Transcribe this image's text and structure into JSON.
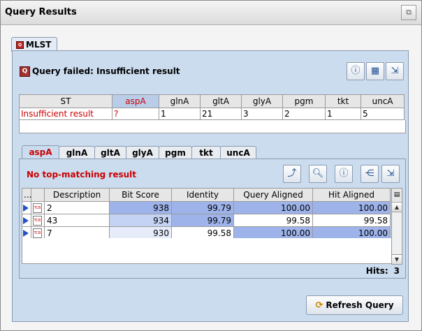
{
  "window": {
    "title": "Query Results",
    "restore_glyph": "⧉"
  },
  "outer_tab": {
    "label": "MLST",
    "icon": "q-icon"
  },
  "status": {
    "icon_glyph": "Q",
    "message": "Query failed: Insufficient result"
  },
  "toolbar_top": [
    {
      "name": "info-icon",
      "glyph": "ⓘ"
    },
    {
      "name": "table-icon",
      "glyph": "▦"
    },
    {
      "name": "export-icon",
      "glyph": "⇲"
    }
  ],
  "st_table": {
    "headers": [
      "ST",
      "aspA",
      "glnA",
      "gltA",
      "glyA",
      "pgm",
      "tkt",
      "uncA"
    ],
    "row": [
      "Insufficient result",
      "?",
      "1",
      "21",
      "3",
      "2",
      "1",
      "5"
    ]
  },
  "inner_tabs": [
    "aspA",
    "glnA",
    "gltA",
    "glyA",
    "pgm",
    "tkt",
    "uncA"
  ],
  "inner_panel": {
    "message": "No top-matching result",
    "toolbar": [
      {
        "name": "chart-icon",
        "glyph": "⤴"
      },
      {
        "name": "magnifier-icon",
        "glyph": "🔍︎"
      },
      {
        "name": "info-icon",
        "glyph": "ⓘ"
      },
      {
        "name": "tree-icon",
        "glyph": "⋲"
      },
      {
        "name": "export-icon",
        "glyph": "⇲"
      }
    ]
  },
  "results_table": {
    "headers": [
      "...",
      "Description",
      "Bit Score",
      "Identity",
      "Query Aligned",
      "Hit Aligned"
    ],
    "rows": [
      {
        "description": "2",
        "bit_score": "938",
        "identity": "99.79",
        "query_aligned": "100.00",
        "hit_aligned": "100.00"
      },
      {
        "description": "43",
        "bit_score": "934",
        "identity": "99.79",
        "query_aligned": "99.58",
        "hit_aligned": "99.58"
      },
      {
        "description": "7",
        "bit_score": "930",
        "identity": "99.58",
        "query_aligned": "100.00",
        "hit_aligned": "100.00"
      }
    ],
    "row_icon": "TCB"
  },
  "hits": {
    "label": "Hits:",
    "value": "3"
  },
  "refresh_button": {
    "label": "Refresh Query",
    "glyph": "⟳"
  },
  "colors": {
    "accent_red": "#cc0000",
    "panel_blue": "#cbdcef",
    "selected_header": "#b9cde9",
    "cell_dark": "#9db3ea",
    "cell_mid": "#c4d2f3",
    "cell_light": "#e6ecfa"
  }
}
